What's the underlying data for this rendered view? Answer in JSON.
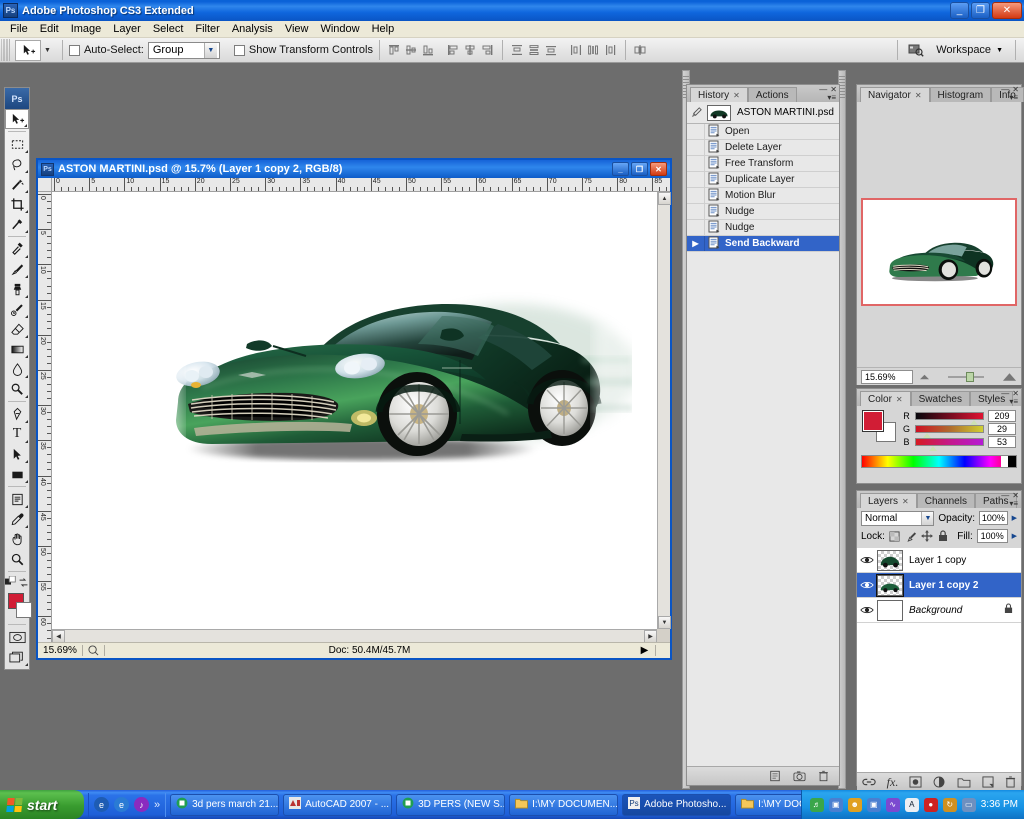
{
  "app": {
    "title": "Adobe Photoshop CS3 Extended",
    "icon": "photoshop-icon",
    "minimize": "_",
    "maximize": "❐",
    "close": "✕"
  },
  "menubar": {
    "items": [
      "File",
      "Edit",
      "Image",
      "Layer",
      "Select",
      "Filter",
      "Analysis",
      "View",
      "Window",
      "Help"
    ]
  },
  "options_bar": {
    "tool_icon": "move-tool-icon",
    "auto_select_label": "Auto-Select:",
    "auto_select_value": "Group",
    "show_transform_label": "Show Transform Controls",
    "workspace_label": "Workspace",
    "align_group_1": [
      "align-top-edges-icon",
      "align-vertical-centers-icon",
      "align-bottom-edges-icon"
    ],
    "align_group_2": [
      "align-left-edges-icon",
      "align-horizontal-centers-icon",
      "align-right-edges-icon"
    ],
    "distribute_group_1": [
      "distribute-top-edges-icon",
      "distribute-vertical-centers-icon",
      "distribute-bottom-edges-icon"
    ],
    "distribute_group_2": [
      "distribute-left-edges-icon",
      "distribute-horizontal-centers-icon",
      "distribute-right-edges-icon"
    ],
    "auto_align_icon": "auto-align-layers-icon"
  },
  "toolbox": {
    "header": "Ps",
    "tools": [
      {
        "name": "move-tool",
        "glyph": "move",
        "selected": true,
        "menu": true
      },
      {
        "name": "rectangular-marquee-tool",
        "glyph": "marquee",
        "selected": false,
        "menu": true
      },
      {
        "name": "lasso-tool",
        "glyph": "lasso",
        "selected": false,
        "menu": true
      },
      {
        "name": "magic-wand-tool",
        "glyph": "wand",
        "selected": false,
        "menu": true
      },
      {
        "name": "crop-tool",
        "glyph": "crop",
        "selected": false,
        "menu": true
      },
      {
        "name": "slice-tool",
        "glyph": "slice",
        "selected": false,
        "menu": true
      },
      {
        "name": "healing-brush-tool",
        "glyph": "heal",
        "selected": false,
        "menu": true
      },
      {
        "name": "brush-tool",
        "glyph": "brush",
        "selected": false,
        "menu": true
      },
      {
        "name": "clone-stamp-tool",
        "glyph": "stamp",
        "selected": false,
        "menu": true
      },
      {
        "name": "history-brush-tool",
        "glyph": "histbrush",
        "selected": false,
        "menu": true
      },
      {
        "name": "eraser-tool",
        "glyph": "eraser",
        "selected": false,
        "menu": true
      },
      {
        "name": "gradient-tool",
        "glyph": "gradient",
        "selected": false,
        "menu": true
      },
      {
        "name": "blur-tool",
        "glyph": "blur",
        "selected": false,
        "menu": true
      },
      {
        "name": "dodge-tool",
        "glyph": "dodge",
        "selected": false,
        "menu": true
      },
      {
        "name": "pen-tool",
        "glyph": "pen",
        "selected": false,
        "menu": true
      },
      {
        "name": "horizontal-type-tool",
        "glyph": "type",
        "selected": false,
        "menu": true
      },
      {
        "name": "path-selection-tool",
        "glyph": "pathsel",
        "selected": false,
        "menu": true
      },
      {
        "name": "rectangle-tool",
        "glyph": "shape",
        "selected": false,
        "menu": true
      },
      {
        "name": "notes-tool",
        "glyph": "notes",
        "selected": false,
        "menu": true
      },
      {
        "name": "eyedropper-tool",
        "glyph": "eyedrop",
        "selected": false,
        "menu": true
      },
      {
        "name": "hand-tool",
        "glyph": "hand",
        "selected": false,
        "menu": false
      },
      {
        "name": "zoom-tool",
        "glyph": "zoom",
        "selected": false,
        "menu": false
      }
    ],
    "foreground_color": "#d11d35",
    "background_color": "#ffffff",
    "quick_mask_icon": "quick-mask-icon",
    "screen_mode_icon": "screen-mode-icon"
  },
  "document": {
    "title": "ASTON MARTINI.psd @ 15.7% (Layer 1 copy 2, RGB/8)",
    "minimize": "_",
    "maximize": "❐",
    "close": "✕",
    "ruler_h_labels": [
      "0",
      "5",
      "10",
      "15",
      "20",
      "25",
      "30",
      "35",
      "40",
      "45",
      "50",
      "55",
      "60",
      "65",
      "70",
      "75",
      "80",
      "85"
    ],
    "ruler_v_labels": [
      "0",
      "5",
      "10",
      "15",
      "20",
      "25",
      "30",
      "35",
      "40",
      "45",
      "50",
      "55",
      "60"
    ],
    "status": {
      "zoom": "15.69%",
      "doc_info": "Doc: 50.4M/45.7M",
      "preview_icon": "preview-icon",
      "more_icon": "more-arrow-icon"
    }
  },
  "history_panel": {
    "tabs": [
      {
        "label": "History",
        "active": true,
        "closable": true
      },
      {
        "label": "Actions",
        "active": false,
        "closable": false
      }
    ],
    "snapshot": "ASTON MARTINI.psd",
    "states": [
      {
        "label": "Open",
        "selected": false
      },
      {
        "label": "Delete Layer",
        "selected": false
      },
      {
        "label": "Free Transform",
        "selected": false
      },
      {
        "label": "Duplicate Layer",
        "selected": false
      },
      {
        "label": "Motion Blur",
        "selected": false
      },
      {
        "label": "Nudge",
        "selected": false
      },
      {
        "label": "Nudge",
        "selected": false
      },
      {
        "label": "Send Backward",
        "selected": true
      }
    ],
    "footer_icons": [
      "new-document-from-state-icon",
      "new-snapshot-icon",
      "delete-state-icon"
    ]
  },
  "navigator_panel": {
    "tabs": [
      {
        "label": "Navigator",
        "active": true,
        "closable": true
      },
      {
        "label": "Histogram",
        "active": false,
        "closable": false
      },
      {
        "label": "Info",
        "active": false,
        "closable": false
      }
    ],
    "zoom_value": "15.69%",
    "zoom_out_icon": "zoom-out-icon",
    "zoom_in_icon": "zoom-in-icon"
  },
  "color_panel": {
    "tabs": [
      {
        "label": "Color",
        "active": true,
        "closable": true
      },
      {
        "label": "Swatches",
        "active": false,
        "closable": false
      },
      {
        "label": "Styles",
        "active": false,
        "closable": false
      }
    ],
    "foreground_color": "#d11d35",
    "background_color": "#ffffff",
    "channels": [
      {
        "label": "R",
        "value": "209",
        "pos": 82
      },
      {
        "label": "G",
        "value": "29",
        "pos": 11
      },
      {
        "label": "B",
        "value": "53",
        "pos": 21
      }
    ]
  },
  "layers_panel": {
    "tabs": [
      {
        "label": "Layers",
        "active": true,
        "closable": true
      },
      {
        "label": "Channels",
        "active": false,
        "closable": false
      },
      {
        "label": "Paths",
        "active": false,
        "closable": false
      }
    ],
    "blend_mode": "Normal",
    "opacity_label": "Opacity:",
    "opacity_value": "100%",
    "lock_label": "Lock:",
    "lock_icons": [
      "lock-transparent-pixels-icon",
      "lock-image-pixels-icon",
      "lock-position-icon",
      "lock-all-icon"
    ],
    "fill_label": "Fill:",
    "fill_value": "100%",
    "layers": [
      {
        "name": "Layer 1 copy",
        "visible": true,
        "selected": false,
        "locked": false,
        "italic": false
      },
      {
        "name": "Layer 1 copy 2",
        "visible": true,
        "selected": true,
        "locked": false,
        "italic": false
      },
      {
        "name": "Background",
        "visible": true,
        "selected": false,
        "locked": true,
        "italic": true
      }
    ],
    "footer_icons": [
      "link-layers-icon",
      "layer-style-fx-icon",
      "add-layer-mask-icon",
      "adjustment-layer-icon",
      "new-group-icon",
      "new-layer-icon",
      "delete-layer-icon"
    ]
  },
  "taskbar": {
    "start_label": "start",
    "quick_launch": [
      "internet-explorer-icon",
      "browser-icon",
      "media-player-icon",
      "chevron-double-right-icon"
    ],
    "buttons": [
      {
        "label": "3d pers march 21...",
        "icon": "window-icon",
        "active": false
      },
      {
        "label": "AutoCAD 2007 - ...",
        "icon": "autocad-icon",
        "active": false
      },
      {
        "label": "3D PERS (NEW S...",
        "icon": "window-icon",
        "active": false
      },
      {
        "label": "I:\\MY DOCUMEN...",
        "icon": "folder-icon",
        "active": false
      },
      {
        "label": "Adobe Photosho...",
        "icon": "photoshop-icon",
        "active": true
      },
      {
        "label": "I:\\MY DOCUMEN...",
        "icon": "folder-icon",
        "active": false
      }
    ],
    "tray_icons": [
      "volume-icon",
      "network-icon",
      "messenger-icon",
      "network2-icon",
      "audio-icon",
      "antivirus-icon",
      "record-icon",
      "update-icon",
      "display-icon"
    ],
    "clock": "3:36 PM"
  },
  "colors": {
    "title_blue": "#0a62d6",
    "selection_blue": "#3264c8",
    "panel_gray": "#d6d6d6",
    "accent_red": "#d11d35",
    "car_green": "#1f5f3a"
  }
}
